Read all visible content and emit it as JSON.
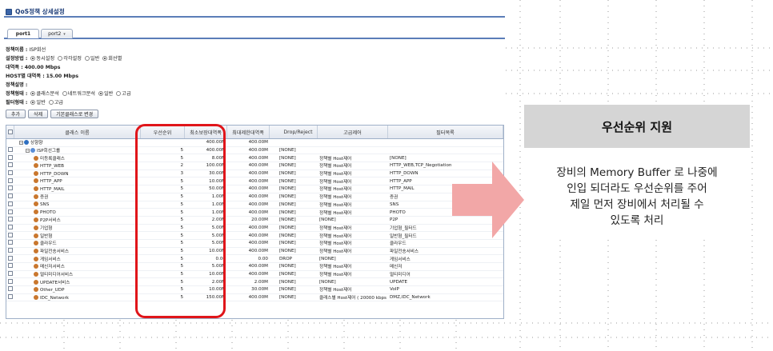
{
  "app": {
    "title": "QoS정책 상세설정",
    "tabs": [
      {
        "label": "port1"
      },
      {
        "label": "port2"
      }
    ],
    "info": {
      "policy_name_label": "정책이름 :",
      "policy_name": "ISP회선",
      "method_label": "설정방법 :",
      "method_options": [
        "동시설정",
        "각각설정",
        "일반",
        "회선별"
      ],
      "bandwidth_label": "대역폭 :",
      "bandwidth": "400.00 Mbps",
      "host_bw_label": "HOST별 대역폭 :",
      "host_bw": "15.00 Mbps",
      "desc_label": "정책설명 :",
      "type_label": "정책형태 :",
      "type_options": [
        "클래스분석",
        "네트워크분석",
        "일반",
        "고급"
      ],
      "filter_label": "필터형태 :",
      "filter_options": [
        "일반",
        "고급"
      ]
    },
    "buttons": [
      {
        "label": "추가"
      },
      {
        "label": "삭제"
      },
      {
        "label": "기본클래스로 변경"
      }
    ],
    "grid": {
      "headers": [
        "클래스 이름",
        "우선순위",
        "최소보장대역폭",
        "최대제한대역폭",
        "Drop/Reject",
        "고급제어",
        "필터목록"
      ],
      "rows": [
        {
          "name": "상향향",
          "prio": "",
          "min": "400.00M",
          "max": "400.00M",
          "drop": "",
          "adv": "",
          "filter": ""
        },
        {
          "name": "ISP회선그룹",
          "prio": "5",
          "min": "400.00M",
          "max": "400.00M",
          "drop": "[NONE]",
          "adv": "",
          "filter": ""
        },
        {
          "name": "미등록클래스",
          "prio": "5",
          "min": "8.00M",
          "max": "400.00M",
          "drop": "[NONE]",
          "adv": "정책별 Host제어",
          "filter": "[NONE]"
        },
        {
          "name": "HTTP_WEB",
          "prio": "2",
          "min": "100.00M",
          "max": "400.00M",
          "drop": "[NONE]",
          "adv": "정책별 Host제어",
          "filter": "HTTP_WEB,TCP_Negotiation"
        },
        {
          "name": "HTTP_DOWN",
          "prio": "3",
          "min": "30.00M",
          "max": "400.00M",
          "drop": "[NONE]",
          "adv": "정책별 Host제어",
          "filter": "HTTP_DOWN"
        },
        {
          "name": "HTTP_APP",
          "prio": "5",
          "min": "10.00M",
          "max": "400.00M",
          "drop": "[NONE]",
          "adv": "정책별 Host제어",
          "filter": "HTTP_APP"
        },
        {
          "name": "HTTP_MAIL",
          "prio": "5",
          "min": "50.00M",
          "max": "400.00M",
          "drop": "[NONE]",
          "adv": "정책별 Host제어",
          "filter": "HTTP_MAIL"
        },
        {
          "name": "증권",
          "prio": "5",
          "min": "1.00M",
          "max": "400.00M",
          "drop": "[NONE]",
          "adv": "정책별 Host제어",
          "filter": "증권"
        },
        {
          "name": "SNS",
          "prio": "5",
          "min": "1.00M",
          "max": "400.00M",
          "drop": "[NONE]",
          "adv": "정책별 Host제어",
          "filter": "SNS"
        },
        {
          "name": "PHOTO",
          "prio": "5",
          "min": "1.00M",
          "max": "400.00M",
          "drop": "[NONE]",
          "adv": "정책별 Host제어",
          "filter": "PHOTO"
        },
        {
          "name": "P2P서비스",
          "prio": "5",
          "min": "2.00M",
          "max": "20.00M",
          "drop": "[NONE]",
          "adv": "[NONE]",
          "filter": "P2P"
        },
        {
          "name": "기업형",
          "prio": "5",
          "min": "5.00M",
          "max": "400.00M",
          "drop": "[NONE]",
          "adv": "정책별 Host제어",
          "filter": "기업형_필터드"
        },
        {
          "name": "일반형",
          "prio": "5",
          "min": "5.00M",
          "max": "400.00M",
          "drop": "[NONE]",
          "adv": "정책별 Host제어",
          "filter": "일반형_필터드"
        },
        {
          "name": "클라우드",
          "prio": "5",
          "min": "5.00M",
          "max": "400.00M",
          "drop": "[NONE]",
          "adv": "정책별 Host제어",
          "filter": "클라우드"
        },
        {
          "name": "파일전송서비스",
          "prio": "5",
          "min": "10.00M",
          "max": "400.00M",
          "drop": "[NONE]",
          "adv": "정책별 Host제어",
          "filter": "파일전송서비스"
        },
        {
          "name": "게임서비스",
          "prio": "5",
          "min": "0.00",
          "max": "0.00",
          "drop": "DROP",
          "adv": "[NONE]",
          "filter": "게임서비스"
        },
        {
          "name": "메신저서비스",
          "prio": "5",
          "min": "5.00M",
          "max": "400.00M",
          "drop": "[NONE]",
          "adv": "정책별 Host제어",
          "filter": "메신저"
        },
        {
          "name": "멀티미디어서비스",
          "prio": "5",
          "min": "10.00M",
          "max": "400.00M",
          "drop": "[NONE]",
          "adv": "정책별 Host제어",
          "filter": "멀티미디어"
        },
        {
          "name": "UPDATE서비스",
          "prio": "5",
          "min": "2.00M",
          "max": "2.00M",
          "drop": "[NONE]",
          "adv": "[NONE]",
          "filter": "UPDATE"
        },
        {
          "name": "Other_UDP",
          "prio": "5",
          "min": "10.00M",
          "max": "30.00M",
          "drop": "[NONE]",
          "adv": "정책별 Host제어",
          "filter": "VoIP"
        },
        {
          "name": "IDC_Network",
          "prio": "5",
          "min": "150.00M",
          "max": "400.00M",
          "drop": "[NONE]",
          "adv": "클래스별 Host제어 ( 20000 kbps )",
          "filter": "DMZ,IDC_Network"
        }
      ]
    }
  },
  "panel": {
    "title": "우선순위 지원",
    "description_lines": [
      "장비의 Memory Buffer 로 나중에",
      "인입 되더라도 우선순위를 주어",
      "제일 먼저 장비에서 처리될 수",
      "있도록 처리"
    ]
  },
  "colors": {
    "highlight": "#e0151a",
    "arrow": "#f2a7a7",
    "panel_header": "#d5d5d5",
    "accent": "#5b7db8"
  }
}
